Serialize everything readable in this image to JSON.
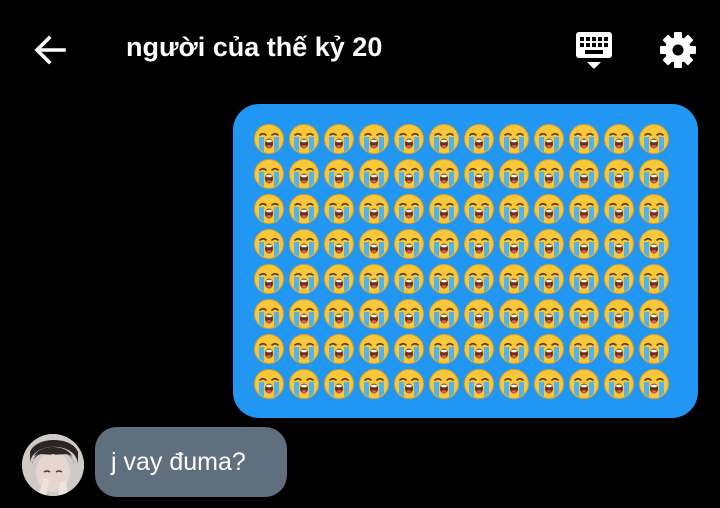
{
  "header": {
    "title": "người của thế kỷ 20",
    "back_icon": "back-arrow-icon",
    "keyboard_icon": "keyboard-icon",
    "settings_icon": "gear-icon"
  },
  "outgoing_message": {
    "emoji": "😭",
    "emoji_name": "loudly-crying-face",
    "rows": 8,
    "columns": 12,
    "bubble_color": "#2196f3"
  },
  "incoming_message": {
    "text": "j vay đuma?",
    "bubble_color": "#5f6f7d"
  },
  "colors": {
    "background": "#000000",
    "text": "#ffffff"
  }
}
